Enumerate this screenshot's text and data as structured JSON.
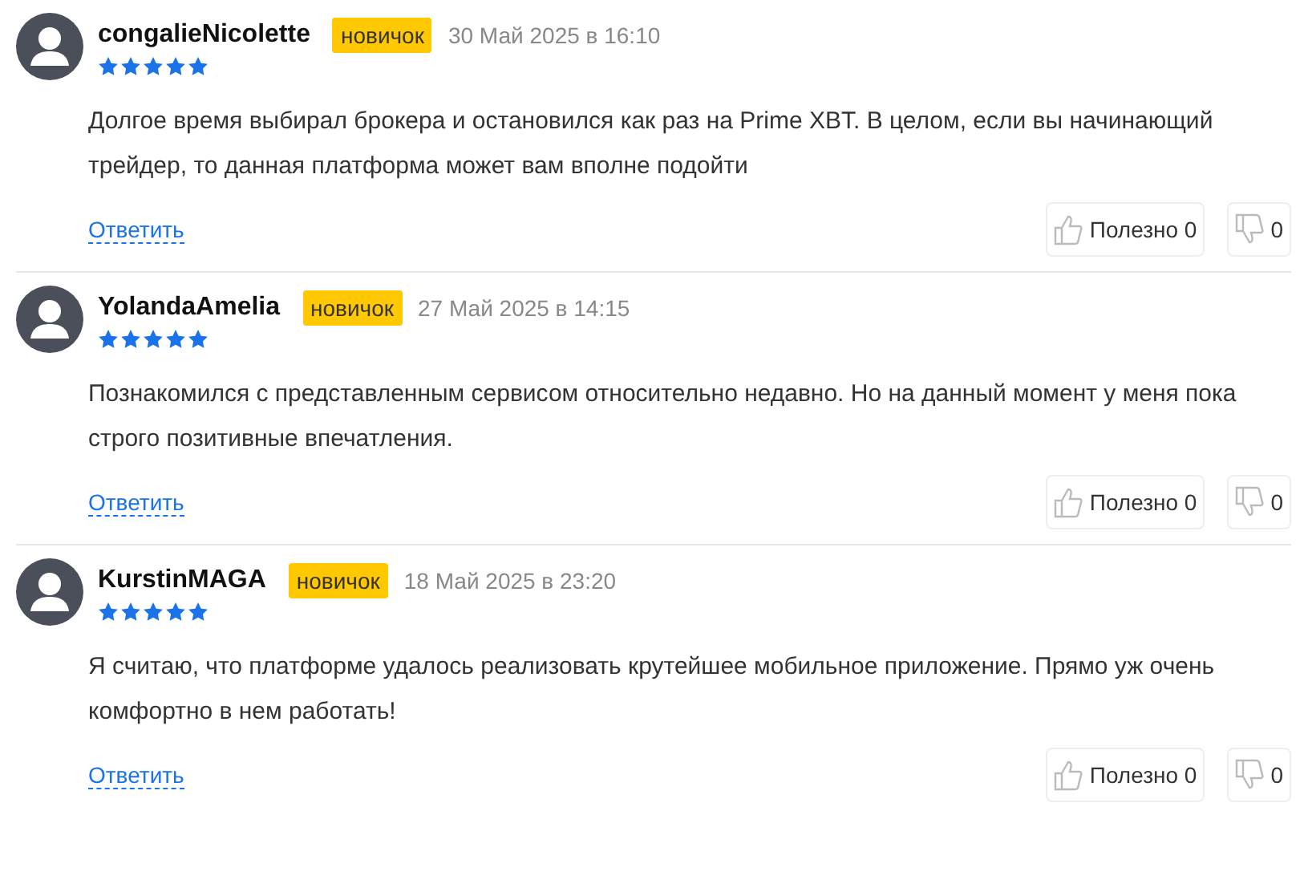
{
  "reviews": [
    {
      "author": "congalieNicolette",
      "badge": "новичок",
      "date": "30 Май 2025 в 16:10",
      "stars": 5,
      "text": "Долгое время выбирал брокера и остановился как раз на Prime XBT. В целом, если вы начинающий трейдер, то данная платформа может вам вполне подойти",
      "reply": "Ответить",
      "helpful": "Полезно 0",
      "unhelpful": "0"
    },
    {
      "author": "YolandaAmelia",
      "badge": "новичок",
      "date": "27 Май 2025 в 14:15",
      "stars": 5,
      "text": "Познакомился с представленным сервисом относительно недавно. Но на данный момент у меня пока строго позитивные впечатления.",
      "reply": "Ответить",
      "helpful": "Полезно 0",
      "unhelpful": "0"
    },
    {
      "author": "KurstinMAGA",
      "badge": "новичок",
      "date": "18 Май 2025 в 23:20",
      "stars": 5,
      "text": "Я считаю, что платформе удалось реализовать крутейшее мобильное приложение. Прямо уж очень комфортно в нем работать!",
      "reply": "Ответить",
      "helpful": "Полезно 0",
      "unhelpful": "0"
    }
  ]
}
